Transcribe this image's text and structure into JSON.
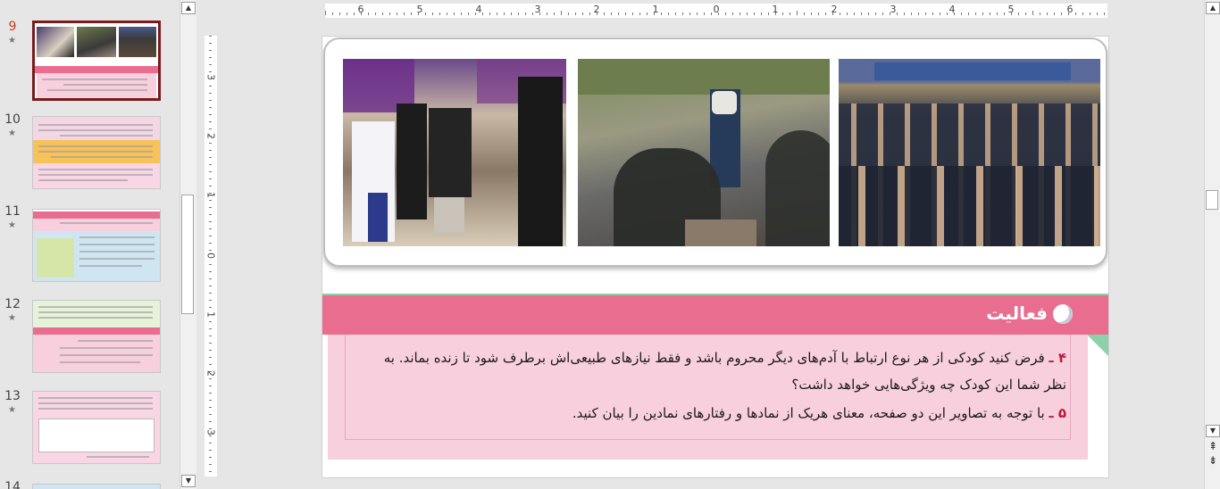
{
  "thumbnails": [
    {
      "number": "9",
      "star": "★",
      "selected": true
    },
    {
      "number": "10",
      "star": "★",
      "selected": false
    },
    {
      "number": "11",
      "star": "★",
      "selected": false
    },
    {
      "number": "12",
      "star": "★",
      "selected": false
    },
    {
      "number": "13",
      "star": "★",
      "selected": false
    },
    {
      "number": "14",
      "star": "",
      "selected": false
    }
  ],
  "ruler": {
    "horizontal_labels": [
      "6",
      "5",
      "4",
      "3",
      "2",
      "1",
      "0",
      "1",
      "2",
      "3",
      "4",
      "5",
      "6"
    ],
    "vertical_labels": [
      "3",
      "2",
      "1",
      "0",
      "1",
      "2",
      "3"
    ]
  },
  "scrollbar": {
    "up_arrow": "▲",
    "down_arrow": "▼",
    "prev_slide": "⇞",
    "next_slide": "⇟"
  },
  "slide": {
    "activity": {
      "title": "فعالیت",
      "q4_number": "۴ ـ",
      "q4_line1": "فرض کنید کودکی از هر نوع ارتباط با آدم‌های دیگر محروم باشد و فقط نیازهای طبیعی‌اش برطرف شود تا زنده بماند. به",
      "q4_line2": "نظر شما این کودک چه ویژگی‌هایی خواهد داشت؟",
      "q5_number": "۵ ـ",
      "q5_line": "با توجه به تصاویر این دو صفحه، معنای هریک از نمادها و رفتارهای نمادین را بیان کنید."
    }
  },
  "colors": {
    "activity_banner": "#e96d8f",
    "activity_box": "#f8cfdc",
    "activity_accent": "#8ed0a8",
    "question_number": "#c0163f",
    "selected_thumb_border": "#7a1a1a",
    "selected_number": "#c43e1c"
  },
  "icons": {
    "slide_star": "star-icon",
    "activity_bullet": "circle-bullet-icon"
  }
}
